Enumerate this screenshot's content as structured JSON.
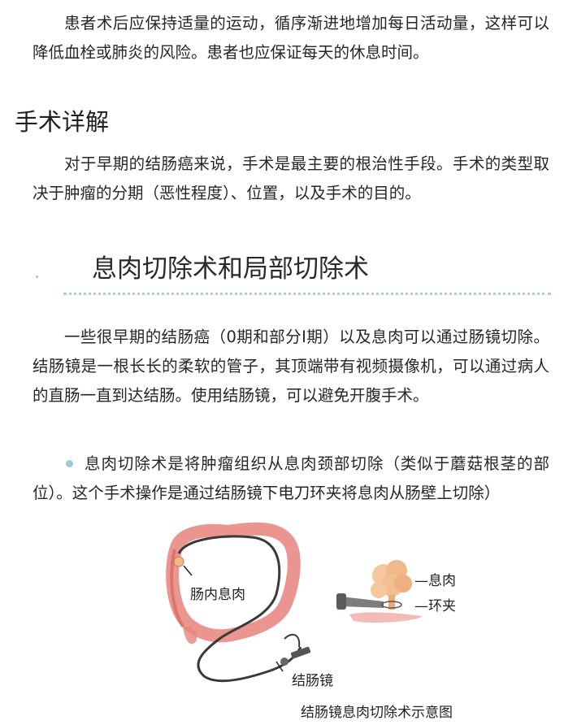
{
  "para1": "患者术后应保持适量的运动，循序渐进地增加每日活动量，这样可以降低血栓或肺炎的风险。患者也应保证每天的休息时间。",
  "heading_surgery": "手术详解",
  "para2": "对于早期的结肠癌来说，手术是最主要的根治性手段。手术的类型取决于肿瘤的分期（恶性程度）、位置，以及手术的目的。",
  "heading_polyp": "息肉切除术和局部切除术",
  "para3": "一些很早期的结肠癌（0期和部分I期）以及息肉可以通过肠镜切除。结肠镜是一根长长的柔软的管子，其顶端带有视频摄像机，可以通过病人的直肠一直到达结肠。使用结肠镜，可以避免开腹手术。",
  "bullet1": "息肉切除术是将肿瘤组织从息肉颈部切除（类似于蘑菇根茎的部位）。这个手术操作是通过结肠镜下电刀环夹将息肉从肠壁上切除）",
  "figure": {
    "label_polyp_inside": "肠内息肉",
    "label_colonoscope": "结肠镜",
    "label_polyp": "—息肉",
    "label_snare": "—环夹",
    "caption": "结肠镜息肉切除术示意图"
  },
  "colors": {
    "bullet": "#9fc9cc",
    "divider": "#a9cfd3",
    "colon": "#e8837c",
    "polyp": "#f0b98a"
  }
}
